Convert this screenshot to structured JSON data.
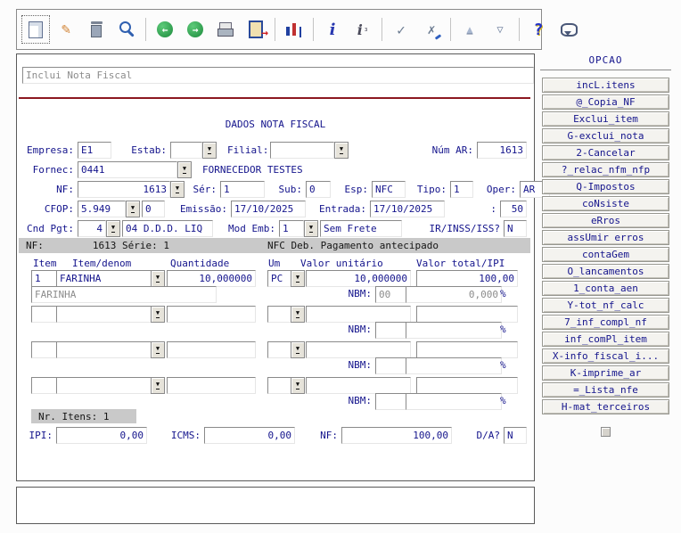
{
  "toolbar": {
    "icons": [
      "new-note-icon",
      "edit-icon",
      "delete-icon",
      "search-icon",
      "prev-record-icon",
      "next-record-icon",
      "print-icon",
      "exit-icon",
      "chart-icon",
      "info-icon",
      "info-detail-icon",
      "confirm-icon",
      "cancel-icon",
      "move-up-icon",
      "move-down-icon",
      "help-icon",
      "message-icon"
    ]
  },
  "window": {
    "title_field": "Inclui Nota Fiscal"
  },
  "form": {
    "section_title": "DADOS NOTA FISCAL",
    "empresa": {
      "label": "Empresa:",
      "value": "E1"
    },
    "estab": {
      "label": "Estab:",
      "value": ""
    },
    "filial": {
      "label": "Filial:",
      "value": ""
    },
    "num_ar": {
      "label": "Núm AR:",
      "value": "1613"
    },
    "fornec": {
      "label": "Fornec:",
      "value": "0441",
      "name": "FORNECEDOR TESTES"
    },
    "nf": {
      "label": "NF:",
      "value": "1613"
    },
    "serie": {
      "label": "Sér:",
      "value": "1"
    },
    "sub": {
      "label": "Sub:",
      "value": "0"
    },
    "esp": {
      "label": "Esp:",
      "value": "NFC"
    },
    "tipo": {
      "label": "Tipo:",
      "value": "1"
    },
    "oper": {
      "label": "Oper:",
      "value": "AR"
    },
    "cfop": {
      "label": "CFOP:",
      "value": "5.949",
      "ext": "0"
    },
    "emissao": {
      "label": "Emissão:",
      "value": "17/10/2025"
    },
    "entrada": {
      "label": "Entrada:",
      "value": "17/10/2025"
    },
    "extra": {
      "label": ":",
      "value": "50"
    },
    "cnd_pgt": {
      "label": "Cnd Pgt:",
      "value": "4",
      "desc": "04 D.D.D. LIQ"
    },
    "mod_emb": {
      "label": "Mod Emb:",
      "value": "1",
      "desc": "Sem Frete"
    },
    "ir_inss": {
      "label": "IR/INSS/ISS?",
      "value": "N"
    }
  },
  "summary_bar": {
    "nf_label": "NF:",
    "nf_value": "1613 Série: 1",
    "description": "NFC Deb. Pagamento antecipado"
  },
  "items": {
    "headers": [
      "Item",
      "Item/denom",
      "Quantidade",
      "Um",
      "Valor unitário",
      "Valor total/IPI"
    ],
    "nbm_label": "NBM:",
    "pct_label": "%",
    "rows": [
      {
        "item": "1",
        "denom": "FARINHA",
        "qty": "10,000000",
        "um": "PC",
        "unit": "10,000000",
        "total": "100,00",
        "desc": "FARINHA",
        "nbm": "00",
        "pct": "0,000"
      },
      {
        "item": "",
        "denom": "",
        "qty": "",
        "um": "",
        "unit": "",
        "total": "",
        "desc": "",
        "nbm": "",
        "pct": ""
      },
      {
        "item": "",
        "denom": "",
        "qty": "",
        "um": "",
        "unit": "",
        "total": "",
        "desc": "",
        "nbm": "",
        "pct": ""
      },
      {
        "item": "",
        "denom": "",
        "qty": "",
        "um": "",
        "unit": "",
        "total": "",
        "desc": "",
        "nbm": "",
        "pct": ""
      }
    ],
    "nr_itens": "Nr. Itens: 1"
  },
  "totals": {
    "ipi": {
      "label": "IPI:",
      "value": "0,00"
    },
    "icms": {
      "label": "ICMS:",
      "value": "0,00"
    },
    "nf": {
      "label": "NF:",
      "value": "100,00"
    },
    "da": {
      "label": "D/A?",
      "value": "N"
    }
  },
  "sidebar": {
    "title": "OPCAO",
    "buttons": [
      "incL.itens",
      "@_Copia_NF",
      "Exclui_item",
      "G-exclui_nota",
      "2-Cancelar",
      "?_relac_nfm_nfp",
      "Q-Impostos",
      "coNsiste",
      "eRros",
      "assUmir erros",
      "contaGem",
      "O_lancamentos",
      "1_conta_aen",
      "Y-tot_nf_calc",
      "7_inf_compl_nf",
      "inf_comPl_item",
      "X-info_fiscal_i...",
      "K-imprime_ar",
      "=_Lista_nfe",
      "H-mat_terceiros"
    ]
  }
}
